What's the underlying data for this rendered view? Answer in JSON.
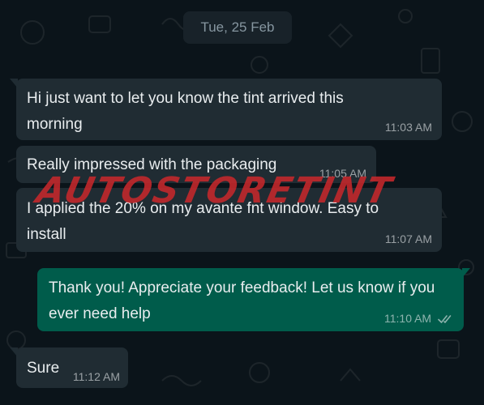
{
  "date_separator": "Tue, 25 Feb",
  "messages": [
    {
      "direction": "incoming",
      "text": "Hi just want to let you know the tint arrived this morning",
      "time": "11:03 AM"
    },
    {
      "direction": "incoming",
      "text": "Really impressed with the packaging",
      "time": "11:05 AM"
    },
    {
      "direction": "incoming",
      "text": "I applied the 20% on my avante fnt window. Easy to install",
      "time": "11:07 AM"
    },
    {
      "direction": "outgoing",
      "text": "Thank you! Appreciate your feedback! Let us know if you ever need help",
      "time": "11:10 AM",
      "status_icon": "double-check-icon"
    },
    {
      "direction": "incoming",
      "text": "Sure",
      "time": "11:12 AM"
    }
  ],
  "watermark": "AUTOSTORETINT",
  "colors": {
    "background": "#0b141a",
    "incoming_bubble": "#202c33",
    "outgoing_bubble": "#005c4b",
    "watermark": "#c6282c"
  }
}
